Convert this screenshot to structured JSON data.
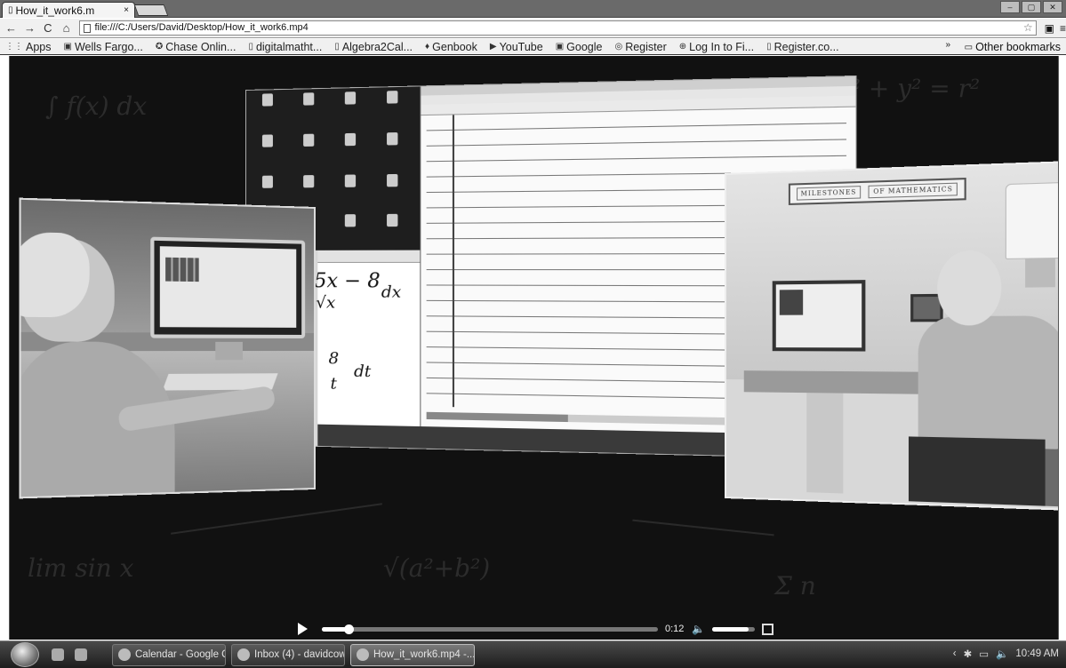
{
  "browser": {
    "tab_title": "How_it_work6.m",
    "tab_close": "×",
    "url": "file:///C:/Users/David/Desktop/How_it_work6.mp4",
    "nav": {
      "back": "←",
      "forward": "→",
      "reload": "C",
      "home": "⌂"
    },
    "bookmarks": [
      {
        "icon": "apps-icon",
        "glyph": "⋮⋮",
        "label": "Apps"
      },
      {
        "icon": "wells-fargo-icon",
        "glyph": "▣",
        "label": "Wells Fargo..."
      },
      {
        "icon": "chase-icon",
        "glyph": "✪",
        "label": "Chase Onlin..."
      },
      {
        "icon": "page-icon",
        "glyph": "▯",
        "label": "digitalmatht..."
      },
      {
        "icon": "page-icon",
        "glyph": "▯",
        "label": "Algebra2Cal..."
      },
      {
        "icon": "genbook-icon",
        "glyph": "♦",
        "label": "Genbook"
      },
      {
        "icon": "youtube-icon",
        "glyph": "▶",
        "label": "YouTube"
      },
      {
        "icon": "google-icon",
        "glyph": "▣",
        "label": "Google"
      },
      {
        "icon": "register-icon",
        "glyph": "◎",
        "label": "Register"
      },
      {
        "icon": "login-icon",
        "glyph": "⊕",
        "label": "Log In to Fi..."
      },
      {
        "icon": "page-icon",
        "glyph": "▯",
        "label": "Register.co..."
      }
    ],
    "bookmarks_more": "»",
    "other_bookmarks": "Other bookmarks"
  },
  "video": {
    "math_line1": "5x − 8",
    "math_line2": "√x",
    "math_dx": "dx",
    "math_frac": "8",
    "math_den": "t",
    "math_dt": "dt",
    "sign_left": "MILESTONES",
    "sign_right": "OF MATHEMATICS",
    "controls": {
      "time": "0:12",
      "progress": 0.08,
      "volume": 0.85
    }
  },
  "taskbar": {
    "items": [
      {
        "label": "Calendar - Google C...",
        "active": false
      },
      {
        "label": "Inbox (4) - davidcow...",
        "active": false
      },
      {
        "label": "How_it_work6.mp4 -...",
        "active": true
      }
    ],
    "clock": "10:49 AM"
  }
}
